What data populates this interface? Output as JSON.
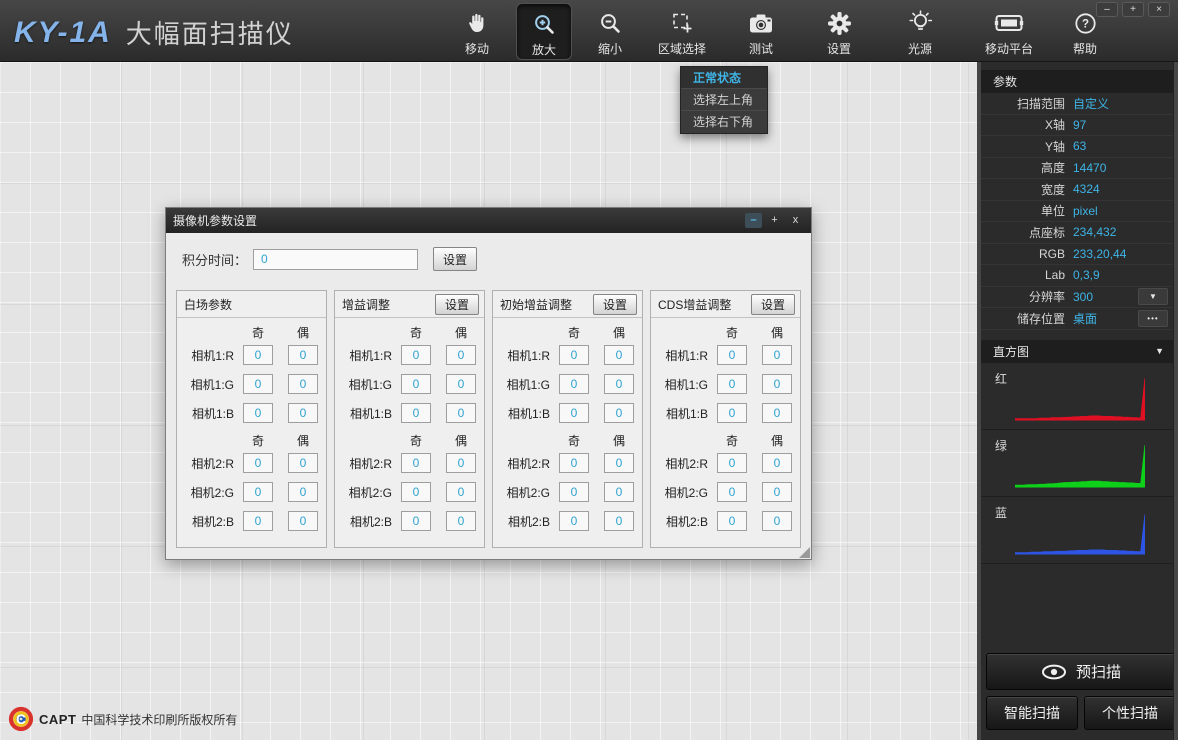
{
  "window": {
    "logo": "KY-1A",
    "title": "大幅面扫描仪",
    "controls": {
      "minimize": "–",
      "maximize": "+",
      "close": "×"
    }
  },
  "toolbar": {
    "items": [
      {
        "label": "移动",
        "icon": "hand-icon",
        "active": false
      },
      {
        "label": "放大",
        "icon": "zoom-in-icon",
        "active": true
      },
      {
        "label": "缩小",
        "icon": "zoom-out-icon",
        "active": false
      },
      {
        "label": "区域选择",
        "icon": "area-select-icon",
        "active": false
      },
      {
        "label": "测试",
        "icon": "camera-icon",
        "active": false
      },
      {
        "label": "设置",
        "icon": "gear-icon",
        "active": false
      },
      {
        "label": "光源",
        "icon": "bulb-icon",
        "active": false
      },
      {
        "label": "移动平台",
        "icon": "platform-icon",
        "active": false
      },
      {
        "label": "帮助",
        "icon": "help-icon",
        "active": false
      }
    ]
  },
  "area_menu": {
    "items": [
      {
        "label": "正常状态",
        "selected": true
      },
      {
        "label": "选择左上角",
        "selected": false
      },
      {
        "label": "选择右下角",
        "selected": false
      }
    ]
  },
  "sidebar": {
    "params_header": "参数",
    "rows": [
      {
        "label": "扫描范围",
        "value": "自定义"
      },
      {
        "label": "X轴",
        "value": "97"
      },
      {
        "label": "Y轴",
        "value": "63"
      },
      {
        "label": "高度",
        "value": "14470"
      },
      {
        "label": "宽度",
        "value": "4324"
      },
      {
        "label": "单位",
        "value": "pixel"
      },
      {
        "label": "点座标",
        "value": "234,432"
      },
      {
        "label": "RGB",
        "value": "233,20,44"
      },
      {
        "label": "Lab",
        "value": "0,3,9"
      },
      {
        "label": "分辨率",
        "value": "300",
        "control": "dropdown"
      },
      {
        "label": "储存位置",
        "value": "桌面",
        "control": "ellipsis"
      }
    ],
    "histogram_header": "直方图",
    "buttons": {
      "prescan": "预扫描",
      "smart_scan": "智能扫描",
      "custom_scan": "个性扫描"
    },
    "accent_color": "#3eb4e6"
  },
  "icons": {
    "caret_down": "▼",
    "ellipsis": "•••"
  },
  "dialog": {
    "title": "摄像机参数设置",
    "controls": {
      "minimize": "–",
      "maximize": "+",
      "close": "x"
    },
    "integration_label": "积分时间：",
    "integration_value": "0",
    "set_button_label": "设置",
    "panels": [
      {
        "title": "白场参数",
        "has_set_button": false
      },
      {
        "title": "增益调整",
        "has_set_button": true
      },
      {
        "title": "初始增益调整",
        "has_set_button": true
      },
      {
        "title": "CDS增益调整",
        "has_set_button": true
      }
    ],
    "groups": [
      {
        "col_headers": [
          "奇",
          "偶"
        ],
        "rows": [
          {
            "label": "相机1:R",
            "odd": "0",
            "even": "0"
          },
          {
            "label": "相机1:G",
            "odd": "0",
            "even": "0"
          },
          {
            "label": "相机1:B",
            "odd": "0",
            "even": "0"
          }
        ]
      },
      {
        "col_headers": [
          "奇",
          "偶"
        ],
        "rows": [
          {
            "label": "相机2:R",
            "odd": "0",
            "even": "0"
          },
          {
            "label": "相机2:G",
            "odd": "0",
            "even": "0"
          },
          {
            "label": "相机2:B",
            "odd": "0",
            "even": "0"
          }
        ]
      }
    ]
  },
  "footer": {
    "logo_text": "CAPT",
    "copyright": "中国科学技术印刷所版权所有"
  },
  "chart_data": [
    {
      "type": "area",
      "label": "红",
      "color": "#e01024",
      "ymax": 100,
      "values": [
        3,
        3,
        3,
        3,
        3,
        3,
        4,
        4,
        4,
        5,
        5,
        5,
        6,
        6,
        7,
        7,
        8,
        8,
        9,
        9,
        9,
        8,
        8,
        8,
        7,
        7,
        6,
        6,
        5,
        5,
        4,
        95
      ]
    },
    {
      "type": "area",
      "label": "绿",
      "color": "#0ecf1a",
      "ymax": 100,
      "values": [
        4,
        4,
        4,
        5,
        5,
        5,
        6,
        6,
        7,
        7,
        8,
        9,
        10,
        10,
        11,
        11,
        12,
        12,
        13,
        13,
        13,
        12,
        12,
        11,
        11,
        10,
        10,
        9,
        9,
        8,
        8,
        95
      ]
    },
    {
      "type": "area",
      "label": "蓝",
      "color": "#2e54e6",
      "ymax": 100,
      "values": [
        3,
        3,
        3,
        3,
        4,
        4,
        4,
        5,
        5,
        5,
        6,
        6,
        6,
        7,
        7,
        8,
        8,
        8,
        9,
        9,
        9,
        9,
        8,
        8,
        8,
        7,
        7,
        6,
        6,
        5,
        5,
        90
      ]
    }
  ]
}
